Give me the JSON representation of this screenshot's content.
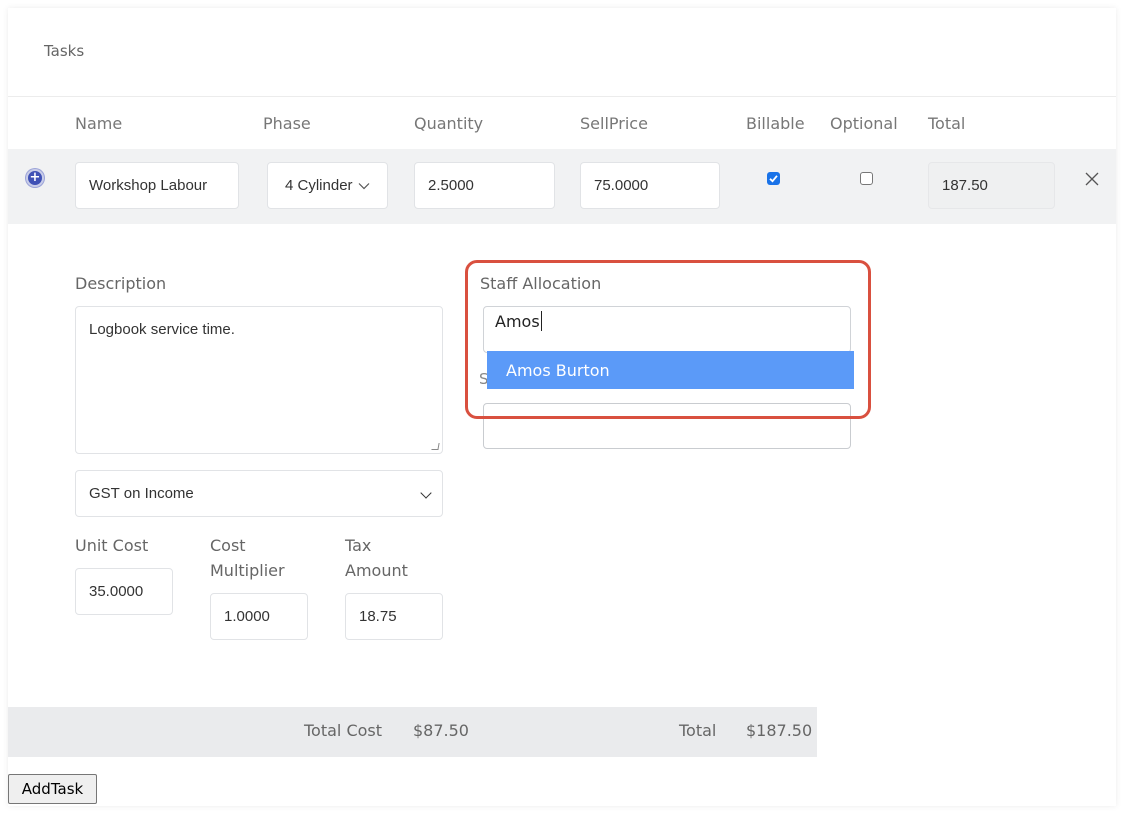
{
  "card": {
    "title": "Tasks"
  },
  "columns": {
    "name": "Name",
    "phase": "Phase",
    "quantity": "Quantity",
    "sell_price": "SellPrice",
    "billable": "Billable",
    "optional": "Optional",
    "total": "Total"
  },
  "task": {
    "name": "Workshop Labour",
    "phase": "4 Cylinder",
    "quantity": "2.5000",
    "sell_price": "75.0000",
    "billable": true,
    "optional": false,
    "total": "187.50"
  },
  "details": {
    "description_label": "Description",
    "description": "Logbook service time.",
    "tax_option": "GST on Income",
    "unit_cost_label": "Unit Cost",
    "unit_cost": "35.0000",
    "cost_multiplier_label_1": "Cost",
    "cost_multiplier_label_2": "Multiplier",
    "cost_multiplier": "1.0000",
    "tax_amount_label_1": "Tax",
    "tax_amount_label_2": "Amount",
    "tax_amount": "18.75",
    "staff_label": "Staff Allocation",
    "staff_query": "Amos",
    "staff_suggestion": "Amos Burton",
    "hidden_label_fragment": "S"
  },
  "totals": {
    "total_cost_label": "Total Cost",
    "total_cost": "$87.50",
    "total_label": "Total",
    "total": "$187.50"
  },
  "actions": {
    "add_task": "AddTask"
  },
  "colors": {
    "highlight": "#d9503f",
    "dropdown": "#5b9af8",
    "checkbox": "#1a73e8",
    "plus": "#3f51b5"
  }
}
